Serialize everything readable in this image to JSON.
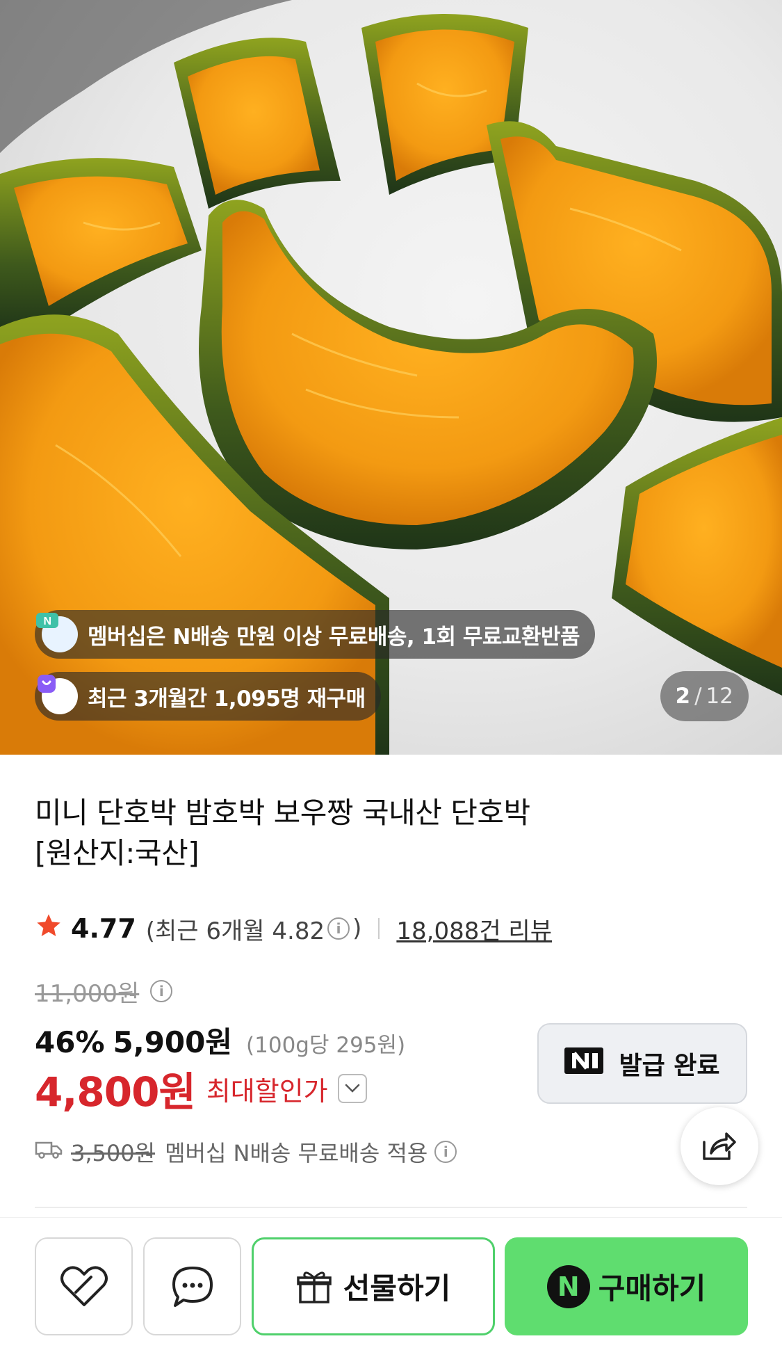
{
  "hero": {
    "image_alt": "steamed kabocha squash wedges on a white plate",
    "membership_notice": "멤버십은 N배송 만원 이상 무료배송, 1회 무료교환반품",
    "repurchase_notice": "최근 3개월간 1,095명 재구매",
    "counter": {
      "current": "2",
      "separator": "/",
      "total": "12"
    }
  },
  "product": {
    "title_line1": "미니 단호박 밤호박 보우짱 국내산 단호박",
    "title_line2": "[원산지:국산]",
    "rating": "4.77",
    "recent_rating_prefix": "(최근 6개월 4.82",
    "recent_rating_suffix": ")",
    "reviews": "18,088건 리뷰",
    "original_price": "11,000원",
    "discount_rate": "46%",
    "sale_price": "5,900원",
    "unit_price": "(100g당 295원)",
    "max_discount_price": "4,800원",
    "max_discount_label": "최대할인가"
  },
  "coupon": {
    "label": "발급 완료"
  },
  "delivery": {
    "original_fee": "3,500원",
    "note": "멤버십 N배송 무료배송 적용"
  },
  "bottom_bar": {
    "gift_label": "선물하기",
    "buy_label": "구매하기",
    "buy_logo": "N"
  },
  "colors": {
    "accent_red": "#d7262c",
    "naver_green": "#5fdd6f",
    "gift_border": "#4fd06b"
  },
  "icons": [
    "n-delivery-icon",
    "shopping-bag-icon",
    "star-icon",
    "info-icon",
    "chevron-down-icon",
    "naver-n-logo-icon",
    "share-icon",
    "truck-icon",
    "heart-icon",
    "chat-icon",
    "gift-icon"
  ]
}
